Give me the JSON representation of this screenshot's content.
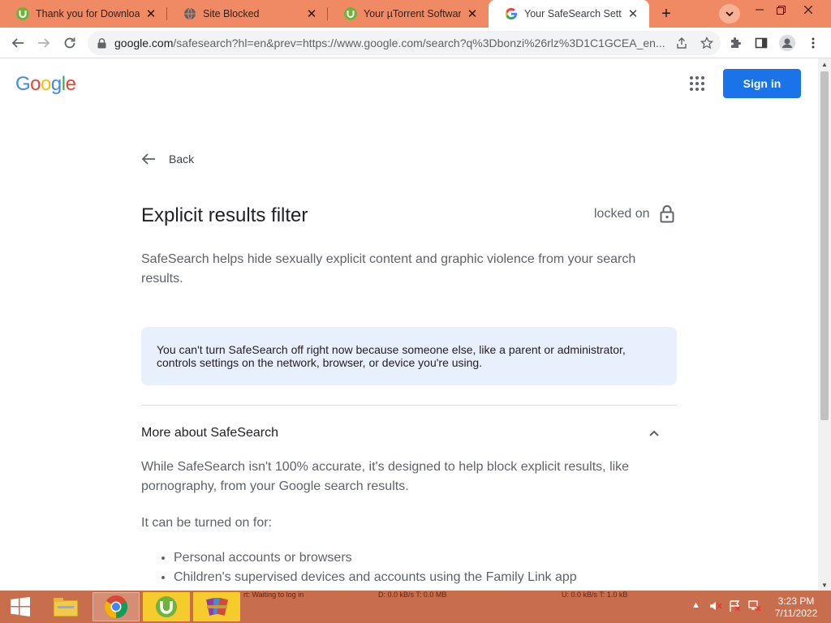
{
  "browser": {
    "tabs": [
      {
        "title": "Thank you for Downloading",
        "favicon": "utorrent-icon",
        "active": false
      },
      {
        "title": "Site Blocked",
        "favicon": "globe-icon",
        "active": false
      },
      {
        "title": "Your µTorrent Software is",
        "favicon": "utorrent-icon",
        "active": false
      },
      {
        "title": "Your SafeSearch Setting",
        "favicon": "google-icon",
        "active": true
      }
    ],
    "new_tab": "+",
    "address": {
      "host": "google.com",
      "path": "/safesearch?hl=en&prev=https://www.google.com/search?q%3Dbonzi%26rlz%3D1C1GCEA_en..."
    }
  },
  "page": {
    "logo": "Google",
    "sign_in": "Sign in",
    "back_label": "Back",
    "title": "Explicit results filter",
    "status": "locked on",
    "description": "SafeSearch helps hide sexually explicit content and graphic violence from your search results.",
    "notice": "You can't turn SafeSearch off right now because someone else, like a parent or administrator, controls settings on the network, browser, or device you're using.",
    "more_heading": "More about SafeSearch",
    "more_body": "While SafeSearch isn't 100% accurate, it's designed to help block explicit results, like pornography, from your Google search results.",
    "turned_on_for": "It can be turned on for:",
    "list": [
      "Personal accounts or browsers",
      "Children's supervised devices and accounts using the Family Link app"
    ]
  },
  "taskbar": {
    "ghost_text": [
      "rt: Waiting to log in",
      "D: 0.0 kB/s T: 0.0 MB",
      "U: 0.0 kB/s T: 1.0 kB"
    ],
    "time": "3:23 PM",
    "date": "7/11/2022"
  },
  "colors": {
    "tabstrip": "#f08a64",
    "accent": "#1a73e8",
    "notice_bg": "#e8f0fe",
    "taskbar": "#c96e4c"
  }
}
